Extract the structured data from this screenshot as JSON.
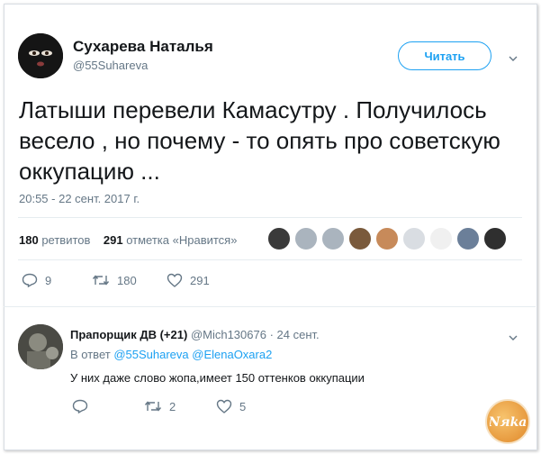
{
  "tweet": {
    "author_name": "Сухарева Наталья",
    "author_handle": "@55Suhareva",
    "follow_label": "Читать",
    "text": "Латыши перевели Камасутру . Получилось весело , но почему - то опять про советскую оккупацию ...",
    "timestamp": "20:55 - 22 сент. 2017 г.",
    "retweets_count": "180",
    "retweets_label": "ретвитов",
    "likes_count": "291",
    "likes_label": "отметка «Нравится»",
    "actions": {
      "reply_count": "9",
      "retweet_count": "180",
      "like_count": "291"
    },
    "likers": [
      "#3a3a3a",
      "#aab4be",
      "#aab4be",
      "#7a5a3c",
      "#c78a5a",
      "#d9dde2",
      "#f0f0f0",
      "#6b7f99",
      "#2f2f2f"
    ]
  },
  "reply": {
    "author_name": "Прапорщик ДВ (+21)",
    "author_handle": "@Mich130676",
    "date": "· 24 сент.",
    "reply_to_prefix": "В ответ",
    "reply_to_users": "@55Suhareva @ElenaOxara2",
    "text": "У них даже слово жопа,имеет 150 оттенков оккупации",
    "actions": {
      "reply_count": "",
      "retweet_count": "2",
      "like_count": "5"
    }
  },
  "colors": {
    "accent": "#1da1f2",
    "muted": "#657786",
    "text": "#14171a"
  },
  "watermark": {
    "text": "Nяka"
  }
}
